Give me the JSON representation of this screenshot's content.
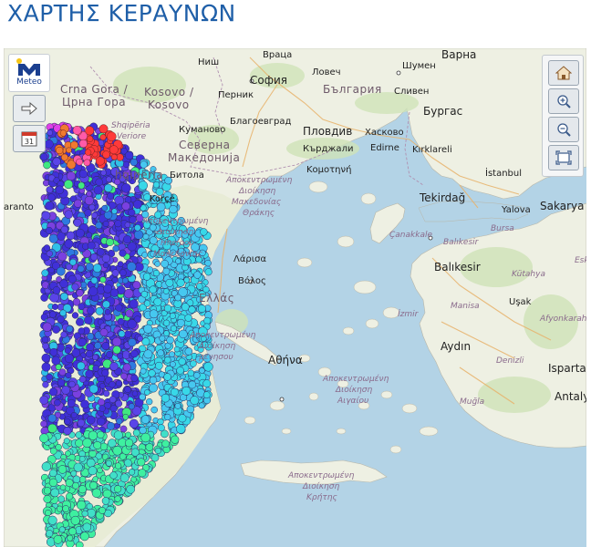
{
  "page": {
    "title": "ΧΑΡΤΗΣ ΚΕΡΑΥΝΩΝ"
  },
  "logo": {
    "text": "Meteo"
  },
  "controls": {
    "left": [
      "next-arrow-icon",
      "calendar-icon"
    ],
    "calendar_day": "31",
    "right": [
      "home-icon",
      "zoom-in-icon",
      "zoom-out-icon",
      "fullscreen-icon"
    ]
  },
  "map": {
    "labels": {
      "crna_gora": "Crna Gora /",
      "crna_gora2": "Црна Гора",
      "kosovo": "Kosovo /",
      "kosovo2": "Kosovo",
      "nis": "Ниш",
      "vraca": "Враца",
      "varna": "Варна",
      "lovech": "Ловеч",
      "shumen": "Шумен",
      "sofia": "София",
      "bulgaria": "България",
      "sliven": "Сливен",
      "pernik": "Перник",
      "burgas": "Бургас",
      "kumanovo": "Куманово",
      "blagoevgrad": "Благоевград",
      "plovdiv": "Пловдив",
      "haskovo": "Хасково",
      "shqiperia": "Shqipëria",
      "veriore": "Veriore",
      "severna": "Северна",
      "makedonija": "Македонија",
      "kardzhali": "Кърджали",
      "edirne": "Edirne",
      "kirklareli": "Kırklareli",
      "komotini": "Κομοτηνή",
      "bitola": "Битола",
      "shqiperia2": "hqipëria",
      "istanbul": "İstanbul",
      "reg_amth_1": "Αποκεντρωμένη",
      "reg_amth_2": "Διοίκηση",
      "reg_amth_3": "Μακεδονίας",
      "reg_amth_4": "Θράκης",
      "tekirdag": "Tekirdağ",
      "yalova": "Yalova",
      "sakarya": "Sakarya",
      "aranto": "aranto",
      "korce": "Korçë",
      "reg_hip_1": "Αποκεντρωμένη",
      "reg_hip_2": "Διοίκηση",
      "reg_hip_3": "Ηπείρου",
      "reg_hip_4": "Μακεδονίας",
      "canakkale": "Çanakkale",
      "balikesir_prov": "Balıkesir",
      "bursa": "Bursa",
      "eski": "Eski",
      "larisa": "Λάρισα",
      "balikesir": "Balıkesir",
      "kutahya": "Kütahya",
      "volos": "Βόλος",
      "ellas": "Ελλάς",
      "manisa": "Manisa",
      "usak": "Uşak",
      "izmir": "İzmir",
      "afyonkarahisar": "Afyonkarah",
      "reg_thess_1": "Αποκεντρωμένη",
      "reg_thess_2": "Διοίκηση",
      "reg_thess_3": "ρενησου",
      "athina": "Αθήνα",
      "aydin": "Aydın",
      "denizli": "Denizli",
      "isparta": "Isparta",
      "reg_aeg_1": "Αποκεντρωμένη",
      "reg_aeg_2": "Διοίκηση",
      "reg_aeg_3": "Αιγαίου",
      "mugla": "Muğla",
      "antalya": "Antaly",
      "reg_crete_1": "Αποκεντρωμένη",
      "reg_crete_2": "Διοίκηση",
      "reg_crete_3": "Κρήτης"
    }
  }
}
